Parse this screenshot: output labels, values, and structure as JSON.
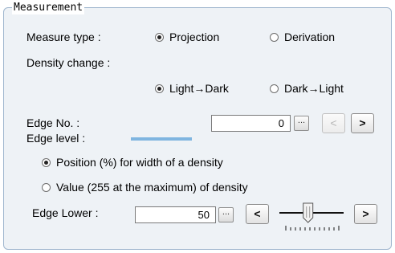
{
  "group": {
    "title": "Measurement"
  },
  "measure_type": {
    "label": "Measure type :",
    "options": [
      {
        "label": "Projection",
        "selected": true
      },
      {
        "label": "Derivation",
        "selected": false
      }
    ]
  },
  "density_change": {
    "label": "Density change :",
    "options": [
      {
        "label": "Light→Dark",
        "selected": true
      },
      {
        "label": "Dark→Light",
        "selected": false
      }
    ]
  },
  "edge_no": {
    "label": "Edge No. :",
    "value": "0",
    "ellipsis": "...",
    "prev": "<",
    "next": ">",
    "prev_disabled": true
  },
  "edge_level": {
    "label": "Edge level :",
    "options": [
      {
        "label": "Position (%) for width of a density",
        "selected": true
      },
      {
        "label": "Value (255 at the maximum) of density",
        "selected": false
      }
    ]
  },
  "edge_lower": {
    "label": "Edge Lower :",
    "value": "50",
    "ellipsis": "...",
    "prev": "<",
    "next": ">",
    "slider_fraction": 0.42
  },
  "colors": {
    "group_bg": "#eef2f6",
    "group_border": "#9fb6ce",
    "level_bar": "#7fb5e0"
  }
}
